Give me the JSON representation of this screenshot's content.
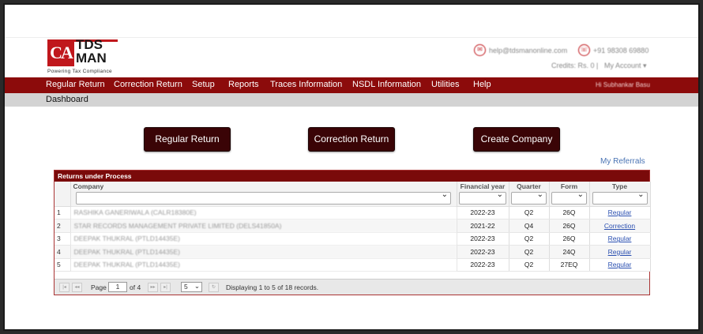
{
  "brand": {
    "ca": "CA",
    "tds": "TDS",
    "man": "MAN",
    "tagline": "Powering Tax Compliance"
  },
  "contact": {
    "email": "help@tdsmanonline.com",
    "phone": "+91 98308 69880"
  },
  "account": {
    "credits": "Credits: Rs. 0  |",
    "my_account": "My Account ▾"
  },
  "menu": {
    "items": [
      "Regular Return",
      "Correction Return",
      "Setup",
      "Reports",
      "Traces Information",
      "NSDL Information",
      "Utilities",
      "Help"
    ],
    "greeting": "Hi Subhankar Basu"
  },
  "breadcrumb": "Dashboard",
  "actions": {
    "regular": "Regular Return",
    "correction": "Correction Return",
    "create": "Create Company"
  },
  "referrals": "My Referrals",
  "grid": {
    "title": "Returns under Process",
    "columns": [
      "Company",
      "Financial year",
      "Quarter",
      "Form",
      "Type"
    ],
    "rows": [
      {
        "n": "1",
        "company": "RASHIKA GANERIWALA (CALR18380E)",
        "fy": "2022-23",
        "q": "Q2",
        "form": "26Q",
        "type": "Regular"
      },
      {
        "n": "2",
        "company": "STAR RECORDS MANAGEMENT PRIVATE LIMITED (DELS41850A)",
        "fy": "2021-22",
        "q": "Q4",
        "form": "26Q",
        "type": "Correction"
      },
      {
        "n": "3",
        "company": "DEEPAK THUKRAL (PTLD14435E)",
        "fy": "2022-23",
        "q": "Q2",
        "form": "26Q",
        "type": "Regular"
      },
      {
        "n": "4",
        "company": "DEEPAK THUKRAL (PTLD14435E)",
        "fy": "2022-23",
        "q": "Q2",
        "form": "24Q",
        "type": "Regular"
      },
      {
        "n": "5",
        "company": "DEEPAK THUKRAL (PTLD14435E)",
        "fy": "2022-23",
        "q": "Q2",
        "form": "27EQ",
        "type": "Regular"
      }
    ],
    "pager": {
      "page_label": "Page",
      "page": "1",
      "of": "of 4",
      "page_size": "5",
      "status": "Displaying 1 to 5 of 18 records."
    }
  },
  "colors": {
    "brand_red": "#c0171c",
    "menu_bg": "#8c0b0b",
    "button_bg": "#3a0406"
  }
}
